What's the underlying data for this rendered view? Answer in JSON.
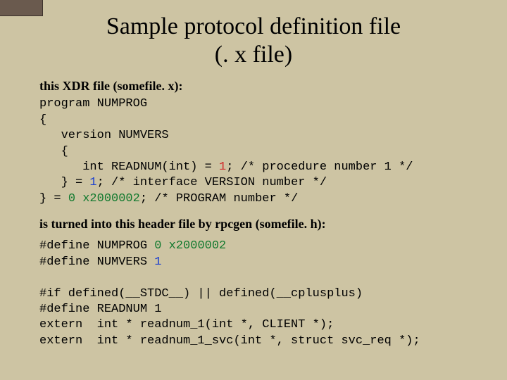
{
  "title_line1": "Sample protocol definition file",
  "title_line2": "(. x file)",
  "xdr_lead": "this XDR file (somefile. x):",
  "xdr": {
    "l1": "program NUMPROG",
    "l2": "{",
    "l3": "   version NUMVERS",
    "l4": "   {",
    "l5a": "      int READNUM(int) = ",
    "l5b": "1",
    "l5c": "; /* procedure number 1 */",
    "l6a": "   } = ",
    "l6b": "1",
    "l6c": "; /* interface VERSION number */",
    "l7a": "} = ",
    "l7b": "0 x2000002",
    "l7c": "; /* PROGRAM number */"
  },
  "header_lead": "is turned into this header file by rpcgen (somefile. h):",
  "hdr": {
    "d1a": "#define NUMPROG ",
    "d1b": "0 x2000002",
    "d2a": "#define NUMVERS ",
    "d2b": "1",
    "blank": "",
    "if1": "#if defined(__STDC__) || defined(__cplusplus)",
    "d3": "#define READNUM 1",
    "ex1": "extern  int * readnum_1(int *, CLIENT *);",
    "ex2": "extern  int * readnum_1_svc(int *, struct svc_req *);"
  }
}
